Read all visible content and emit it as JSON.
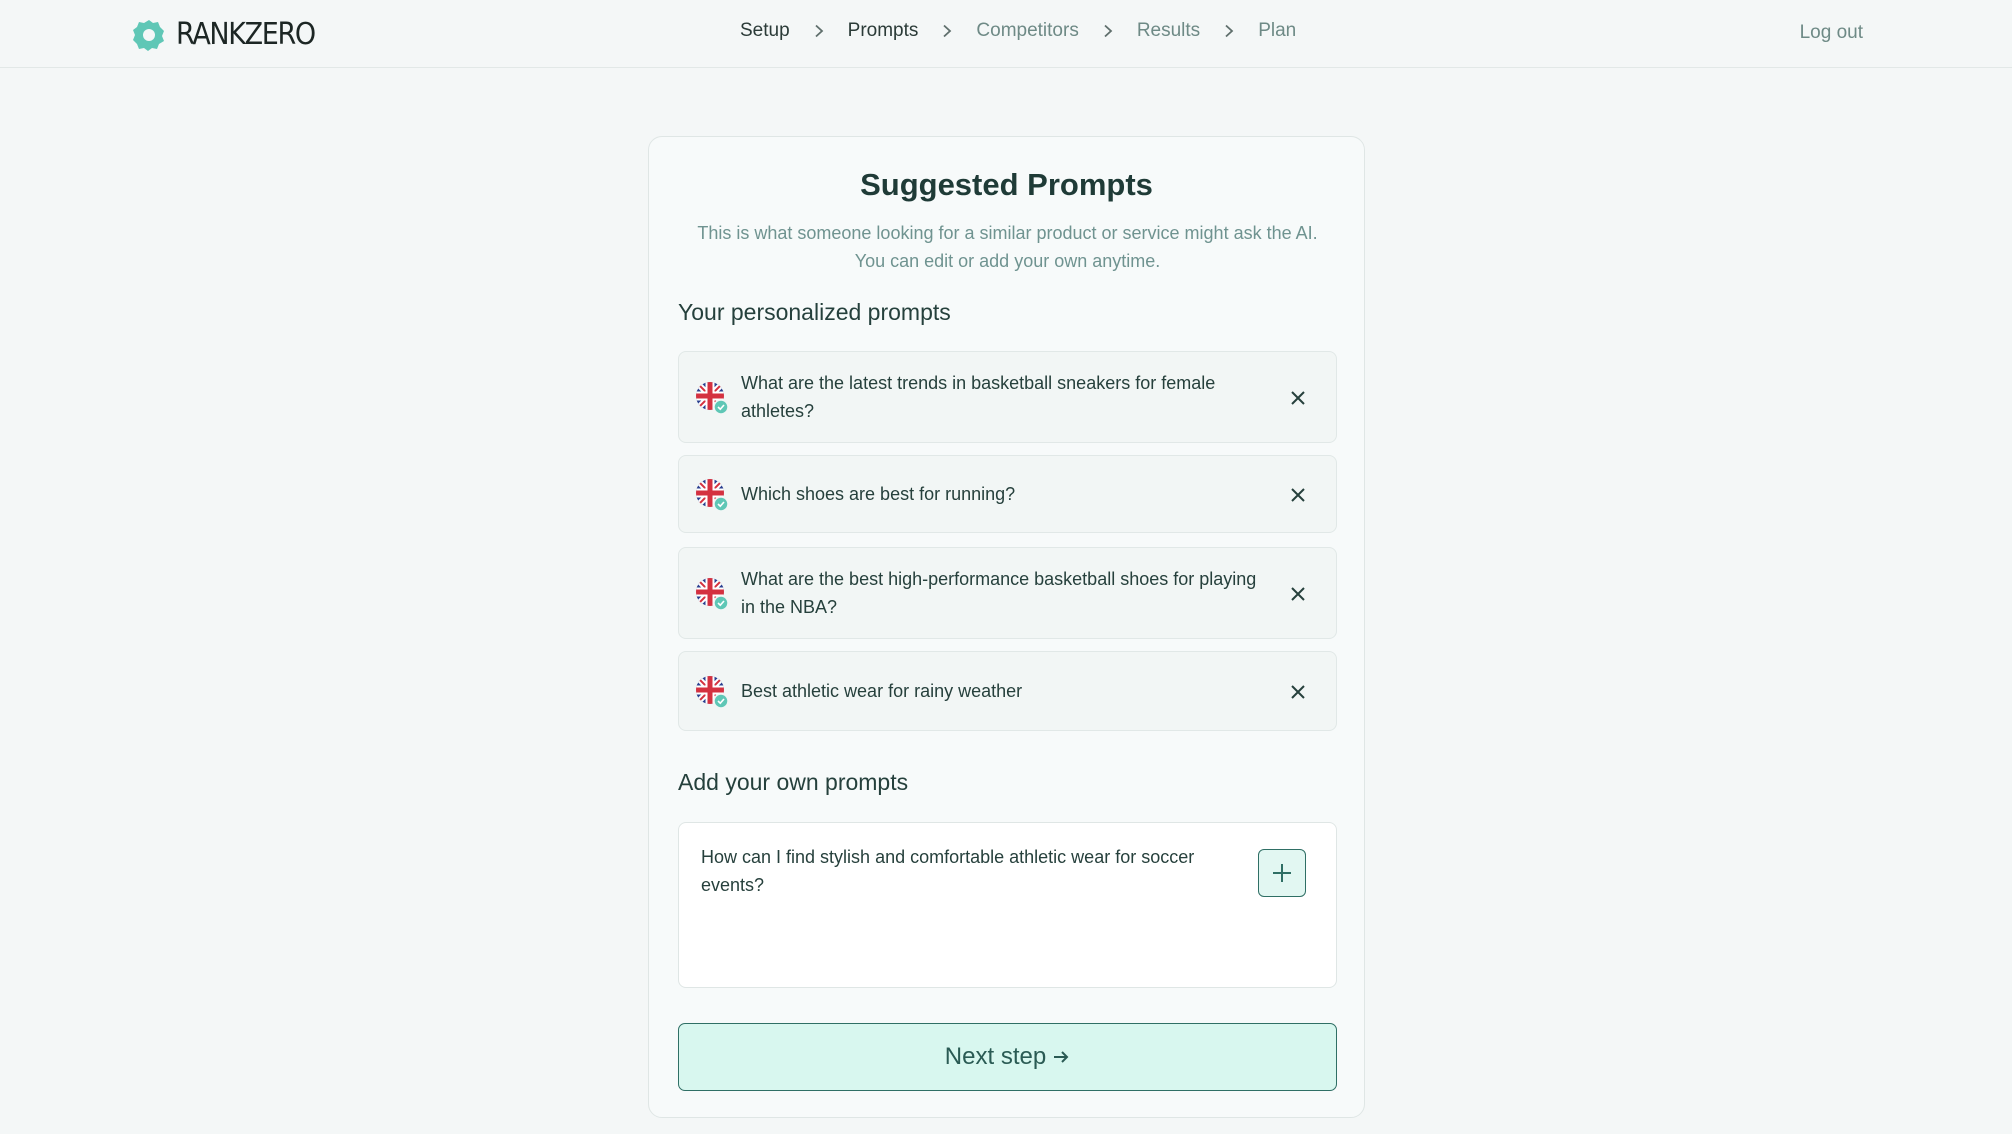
{
  "brand": {
    "name": "RANKZERO",
    "accent": "#5fc7b6"
  },
  "nav": {
    "steps": [
      {
        "label": "Setup",
        "state": "done"
      },
      {
        "label": "Prompts",
        "state": "current"
      },
      {
        "label": "Competitors",
        "state": "upcoming"
      },
      {
        "label": "Results",
        "state": "upcoming"
      },
      {
        "label": "Plan",
        "state": "upcoming"
      }
    ],
    "logout_label": "Log out"
  },
  "card": {
    "title": "Suggested Prompts",
    "subtitle_line1": "This is what someone looking for a similar product or service might ask the AI.",
    "subtitle_line2": "You can edit or add your own anytime.",
    "personalized_heading": "Your personalized prompts",
    "prompts": [
      {
        "text": "What are the latest trends in basketball sneakers for female athletes?",
        "flag_icon": "uk-flag-icon"
      },
      {
        "text": "Which shoes are best for running?",
        "flag_icon": "uk-flag-icon"
      },
      {
        "text": "What are the best high-performance basketball shoes for playing in the NBA?",
        "flag_icon": "uk-flag-icon"
      },
      {
        "text": "Best athletic wear for rainy weather",
        "flag_icon": "uk-flag-icon"
      }
    ],
    "add_heading": "Add your own prompts",
    "add_input_value": "How can I find stylish and comfortable athletic wear for soccer events?",
    "next_label": "Next step"
  }
}
